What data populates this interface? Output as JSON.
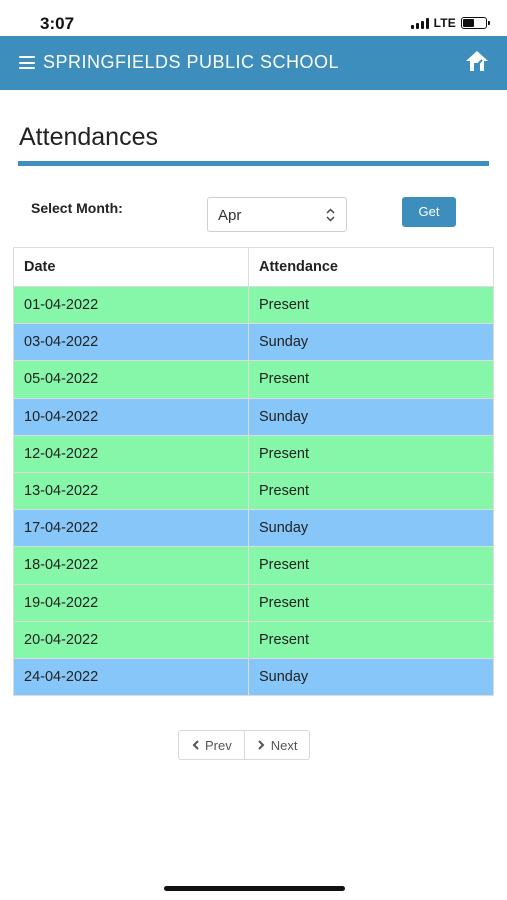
{
  "status_bar": {
    "time": "3:07",
    "network": "LTE"
  },
  "header": {
    "title": "SPRINGFIELDS PUBLIC SCHOOL"
  },
  "page": {
    "title": "Attendances"
  },
  "filter": {
    "month_label": "Select Month:",
    "month_value": "Apr",
    "get_label": "Get"
  },
  "table": {
    "headers": [
      "Date",
      "Attendance"
    ],
    "rows": [
      {
        "date": "01-04-2022",
        "status": "Present"
      },
      {
        "date": "03-04-2022",
        "status": "Sunday"
      },
      {
        "date": "05-04-2022",
        "status": "Present"
      },
      {
        "date": "10-04-2022",
        "status": "Sunday"
      },
      {
        "date": "12-04-2022",
        "status": "Present"
      },
      {
        "date": "13-04-2022",
        "status": "Present"
      },
      {
        "date": "17-04-2022",
        "status": "Sunday"
      },
      {
        "date": "18-04-2022",
        "status": "Present"
      },
      {
        "date": "19-04-2022",
        "status": "Present"
      },
      {
        "date": "20-04-2022",
        "status": "Present"
      },
      {
        "date": "24-04-2022",
        "status": "Sunday"
      }
    ]
  },
  "pager": {
    "prev_label": "Prev",
    "next_label": "Next"
  },
  "colors": {
    "accent": "#3d8ebd",
    "present_row": "#86f7a8",
    "sunday_row": "#86c6f8"
  }
}
